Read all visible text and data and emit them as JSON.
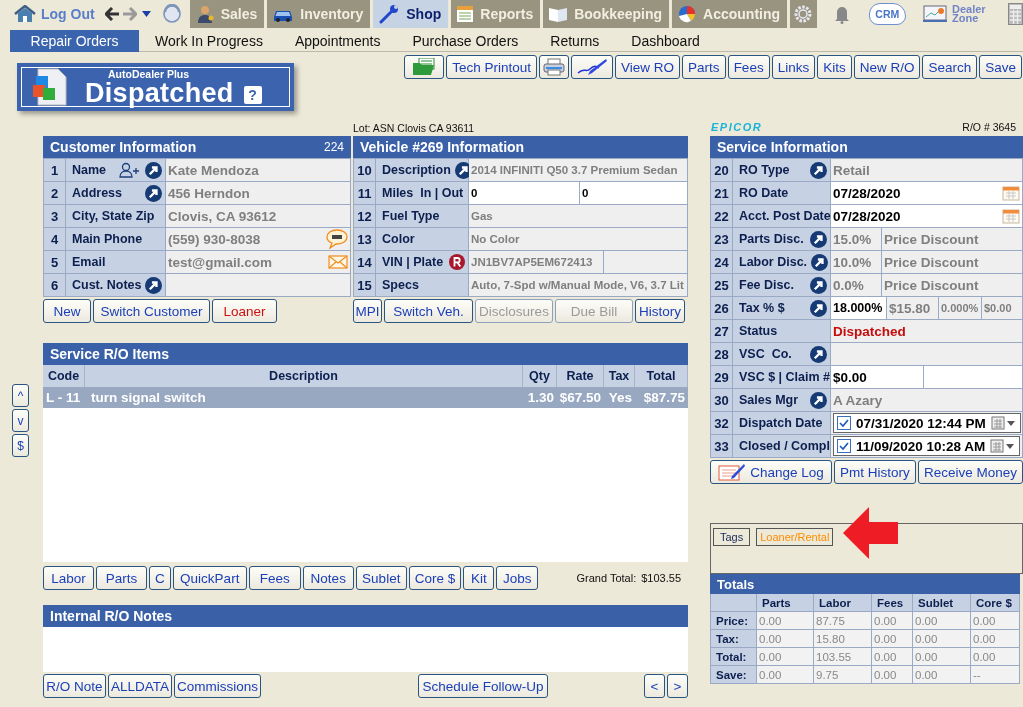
{
  "top_nav": {
    "logout": "Log Out",
    "tabs": [
      {
        "label": "Sales",
        "selected": false
      },
      {
        "label": "Inventory",
        "selected": false
      },
      {
        "label": "Shop",
        "selected": true
      },
      {
        "label": "Reports",
        "selected": false
      },
      {
        "label": "Bookkeeping",
        "selected": false
      },
      {
        "label": "Accounting",
        "selected": false
      }
    ],
    "crm": "CRM",
    "dealer_zone": "Dealer Zone"
  },
  "sub_nav": [
    {
      "label": "Repair Orders",
      "selected": true
    },
    {
      "label": "Work In Progress",
      "selected": false
    },
    {
      "label": "Appointments",
      "selected": false
    },
    {
      "label": "Purchase Orders",
      "selected": false
    },
    {
      "label": "Returns",
      "selected": false
    },
    {
      "label": "Dashboard",
      "selected": false
    }
  ],
  "banner": {
    "product": "AutoDealer Plus",
    "status": "Dispatched",
    "help": "?"
  },
  "toolbar": [
    {
      "kind": "folder"
    },
    {
      "kind": "text",
      "label": "Tech Printout"
    },
    {
      "kind": "printer"
    },
    {
      "kind": "signature"
    },
    {
      "kind": "text",
      "label": "View RO"
    },
    {
      "kind": "text",
      "label": "Parts"
    },
    {
      "kind": "text",
      "label": "Fees"
    },
    {
      "kind": "text",
      "label": "Links"
    },
    {
      "kind": "text",
      "label": "Kits"
    },
    {
      "kind": "text",
      "label": "New R/O"
    },
    {
      "kind": "text",
      "label": "Search"
    },
    {
      "kind": "text",
      "label": "Save"
    }
  ],
  "customer": {
    "title": "Customer Information",
    "count": "224",
    "rows": [
      {
        "num": "1",
        "label": "Name",
        "kind": "add-person",
        "lookup": true,
        "cells": [
          {
            "text": "Kate Mendoza",
            "editable": false
          }
        ]
      },
      {
        "num": "2",
        "label": "Address",
        "kind": "plain",
        "lookup": true,
        "cells": [
          {
            "text": "456 Herndon",
            "editable": false
          }
        ]
      },
      {
        "num": "3",
        "label": "City, State Zip",
        "kind": "plain",
        "lookup": false,
        "cells": [
          {
            "text": "Clovis, CA 93612",
            "editable": false
          }
        ]
      },
      {
        "num": "4",
        "label": "Main Phone",
        "kind": "sms",
        "lookup": false,
        "cells": [
          {
            "text": "(559) 930-8038",
            "editable": false
          }
        ]
      },
      {
        "num": "5",
        "label": "Email",
        "kind": "email",
        "lookup": false,
        "cells": [
          {
            "text": "test@gmail.com",
            "editable": false
          }
        ]
      },
      {
        "num": "6",
        "label": "Cust. Notes",
        "kind": "plain",
        "lookup": true,
        "cells": [
          {
            "editable": false
          }
        ]
      }
    ],
    "buttons": [
      {
        "label": "New",
        "warning": false,
        "disabled": false
      },
      {
        "label": "Switch Customer",
        "warning": false,
        "disabled": false
      },
      {
        "label": "Loaner",
        "warning": true,
        "disabled": false
      }
    ]
  },
  "vehicle": {
    "lot": "Lot: ASN Clovis CA 93611",
    "title": "Vehicle #269 Information",
    "rows": [
      {
        "num": "10",
        "label": "Description",
        "kind": "plain",
        "lookup": true,
        "cells": [
          {
            "text": "2014 INFINITI Q50 3.7 Premium Sedan",
            "editable": false
          }
        ]
      },
      {
        "num": "11",
        "label": "Miles  In | Out",
        "kind": "plain",
        "lookup": false,
        "cells": [
          {
            "text": "0",
            "editable": true
          },
          {
            "text": "0",
            "editable": true
          }
        ]
      },
      {
        "num": "12",
        "label": "Fuel Type",
        "kind": "plain",
        "lookup": false,
        "cells": [
          {
            "text": "Gas",
            "editable": false
          }
        ]
      },
      {
        "num": "13",
        "label": "Color",
        "kind": "plain",
        "lookup": false,
        "cells": [
          {
            "text": "No Color",
            "editable": false
          }
        ]
      },
      {
        "num": "14",
        "label": "VIN | Plate",
        "kind": "registration",
        "lookup": false,
        "cells": [
          {
            "text": "JN1BV7AP5EM672413",
            "editable": false
          },
          {
            "editable": false
          }
        ]
      },
      {
        "num": "15",
        "label": "Specs",
        "kind": "plain",
        "lookup": false,
        "cells": [
          {
            "text": "Auto, 7-Spd w/Manual Mode, V6, 3.7 Lit",
            "editable": false
          }
        ]
      }
    ],
    "buttons": [
      {
        "label": "MPI",
        "warning": false,
        "disabled": false
      },
      {
        "label": "Switch Veh.",
        "warning": false,
        "disabled": false
      },
      {
        "label": "Disclosures",
        "warning": false,
        "disabled": true
      },
      {
        "label": "Due Bill",
        "warning": false,
        "disabled": true
      },
      {
        "label": "History",
        "warning": false,
        "disabled": false
      }
    ]
  },
  "items": {
    "title": "Service R/O Items",
    "side_buttons": [
      "^",
      "v",
      "$"
    ],
    "columns": [
      "Code",
      "Description",
      "Qty",
      "Rate",
      "Tax",
      "Total"
    ],
    "rows": [
      {
        "cells": [
          "L - 11",
          "turn signal switch",
          "1.30",
          "$67.50",
          "Yes",
          "$87.75"
        ],
        "selected": true
      }
    ],
    "buttons": [
      "Labor",
      "Parts",
      "C",
      "QuickPart",
      "Fees",
      "Notes",
      "Sublet",
      "Core $",
      "Kit",
      "Jobs"
    ],
    "grand_total_label": "Grand Total:",
    "grand_total": "$103.55"
  },
  "notes": {
    "title": "Internal R/O Notes",
    "buttons_left": [
      "R/O Note",
      "ALLDATA",
      "Commissions"
    ],
    "button_center": "Schedule Follow-Up",
    "buttons_right": [
      "<",
      ">"
    ]
  },
  "service": {
    "logo": "EPICOR",
    "ro_number": "R/O # 3645",
    "title": "Service Information",
    "rows": [
      {
        "num": "20",
        "label": "RO Type",
        "kind": "plain",
        "lookup": true,
        "cells": [
          {
            "text": "Retail",
            "editable": false
          }
        ]
      },
      {
        "num": "21",
        "label": "RO Date",
        "kind": "date",
        "lookup": false,
        "cells": [
          {
            "text": "07/28/2020",
            "editable": true
          }
        ]
      },
      {
        "num": "22",
        "label": "Acct. Post Date",
        "kind": "date",
        "lookup": false,
        "cells": [
          {
            "text": "07/28/2020",
            "editable": true
          }
        ]
      },
      {
        "num": "23",
        "label": "Parts Disc.",
        "kind": "plain",
        "lookup": true,
        "cells": [
          {
            "text": "15.0%",
            "editable": false
          },
          {
            "text": "Price Discount",
            "editable": false
          }
        ]
      },
      {
        "num": "24",
        "label": "Labor Disc.",
        "kind": "plain",
        "lookup": true,
        "cells": [
          {
            "text": "10.0%",
            "editable": false
          },
          {
            "text": "Price Discount",
            "editable": false
          }
        ]
      },
      {
        "num": "25",
        "label": "Fee Disc.",
        "kind": "plain",
        "lookup": true,
        "cells": [
          {
            "text": "0.0%",
            "editable": false
          },
          {
            "text": "Price Discount",
            "editable": false
          }
        ]
      },
      {
        "num": "26",
        "label": "Tax % $",
        "kind": "plain",
        "lookup": true,
        "cells": [
          {
            "text": "18.000%",
            "editable": true
          },
          {
            "text": "$15.80",
            "editable": false
          },
          {
            "text": "0.000%",
            "editable": false
          },
          {
            "text": "$0.00",
            "editable": false
          }
        ]
      },
      {
        "num": "27",
        "label": "Status",
        "kind": "status",
        "lookup": false,
        "cells": [
          {
            "text": "Dispatched",
            "editable": false
          }
        ]
      },
      {
        "num": "28",
        "label": "VSC  Co.",
        "kind": "plain",
        "lookup": true,
        "cells": [
          {
            "editable": false
          }
        ]
      },
      {
        "num": "29",
        "label": "VSC $ | Claim #",
        "kind": "plain",
        "lookup": false,
        "cells": [
          {
            "text": "$0.00",
            "editable": true
          },
          {
            "editable": true
          }
        ]
      },
      {
        "num": "30",
        "label": "Sales Mgr",
        "kind": "plain",
        "lookup": true,
        "cells": [
          {
            "text": "A Azary",
            "editable": false
          }
        ]
      },
      {
        "num": "32",
        "label": "Dispatch Date",
        "kind": "datetime",
        "lookup": false,
        "checked": true,
        "cells": [
          {
            "text": "07/31/2020 12:44 PM",
            "editable": true
          }
        ]
      },
      {
        "num": "33",
        "label": "Closed / Compl",
        "kind": "datetime",
        "lookup": false,
        "checked": true,
        "cells": [
          {
            "text": "11/09/2020 10:28 AM",
            "editable": true
          }
        ]
      }
    ],
    "buttons": [
      {
        "kind": "log",
        "label": "Change Log"
      },
      {
        "kind": "text",
        "label": "Pmt History"
      },
      {
        "kind": "text",
        "label": "Receive Money"
      }
    ]
  },
  "tags": {
    "label": "Tags",
    "items": [
      {
        "label": "Loaner/Rental",
        "color": "#ff8c00"
      }
    ]
  },
  "totals": {
    "title": "Totals",
    "columns": [
      "Parts",
      "Labor",
      "Fees",
      "Sublet",
      "Core $"
    ],
    "rows": [
      {
        "label": "Price:",
        "values": [
          "0.00",
          "87.75",
          "0.00",
          "0.00",
          "0.00"
        ]
      },
      {
        "label": "Tax:",
        "values": [
          "0.00",
          "15.80",
          "0.00",
          "0.00",
          "0.00"
        ]
      },
      {
        "label": "Total:",
        "values": [
          "0.00",
          "103.55",
          "0.00",
          "0.00",
          "0.00"
        ]
      },
      {
        "label": "Save:",
        "values": [
          "0.00",
          "9.75",
          "0.00",
          "0.00",
          "--"
        ]
      }
    ]
  }
}
